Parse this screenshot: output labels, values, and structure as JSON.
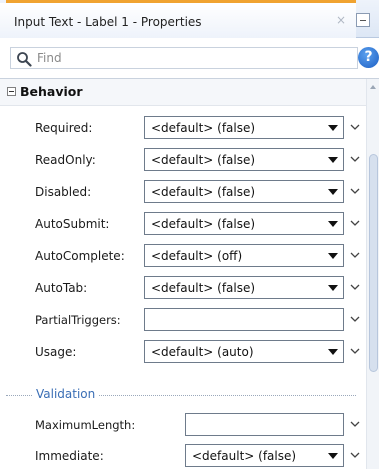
{
  "window": {
    "title": "Input Text - Label 1 - Properties",
    "close_glyph": "×"
  },
  "search": {
    "placeholder": "Find",
    "help_glyph": "?"
  },
  "section": {
    "title": "Behavior"
  },
  "properties": [
    {
      "label": "Required:",
      "value": "<default> (false)",
      "kind": "select"
    },
    {
      "label": "ReadOnly:",
      "value": "<default> (false)",
      "kind": "select"
    },
    {
      "label": "Disabled:",
      "value": "<default> (false)",
      "kind": "select"
    },
    {
      "label": "AutoSubmit:",
      "value": "<default> (false)",
      "kind": "select"
    },
    {
      "label": "AutoComplete:",
      "value": "<default> (off)",
      "kind": "select"
    },
    {
      "label": "AutoTab:",
      "value": "<default> (false)",
      "kind": "select"
    },
    {
      "label": "PartialTriggers:",
      "value": "",
      "kind": "text"
    },
    {
      "label": "Usage:",
      "value": "<default> (auto)",
      "kind": "select"
    }
  ],
  "subsection": {
    "title": "Validation"
  },
  "validation_properties": [
    {
      "label": "MaximumLength:",
      "value": "",
      "kind": "text"
    },
    {
      "label": "Immediate:",
      "value": "<default> (false)",
      "kind": "select"
    }
  ],
  "colors": {
    "accent": "#f0a330",
    "subsection_title": "#3a6eb5",
    "help_icon": "#1d5fc4"
  }
}
